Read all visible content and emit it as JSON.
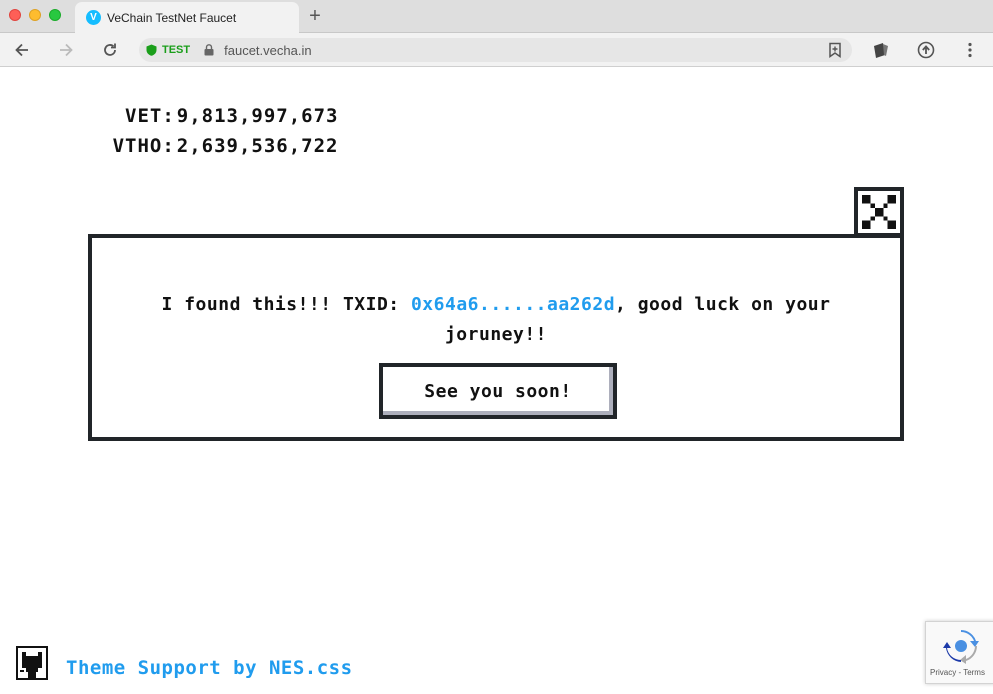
{
  "browser": {
    "tab": {
      "title": "VeChain TestNet Faucet",
      "favicon_letter": "V"
    },
    "new_tab_label": "+",
    "address_bar": {
      "badge": "TEST",
      "url": "faucet.vecha.in"
    },
    "icons": {
      "back": "arrow-left-icon",
      "forward": "arrow-right-icon",
      "reload": "reload-icon",
      "bookmark": "bookmark-icon",
      "extension_one": "wallet-extension-icon",
      "extension_two": "upload-extension-icon",
      "menu": "more-vertical-icon"
    }
  },
  "balances": [
    {
      "label": "VET:",
      "value": "9,813,997,673"
    },
    {
      "label": "VTHO:",
      "value": "2,639,536,722"
    }
  ],
  "dialog": {
    "message_prefix": "I found this!!! TXID: ",
    "txid": "0x64a6......aa262d",
    "message_suffix": ", good luck on your joruney!!",
    "button_label": "See you soon!"
  },
  "footer": {
    "link_text": "Theme Support by NES.css"
  },
  "recaptcha": {
    "links": "Privacy - Terms"
  },
  "colors": {
    "link": "#209cee",
    "border": "#212529",
    "test_badge": "#1a9e1a"
  }
}
